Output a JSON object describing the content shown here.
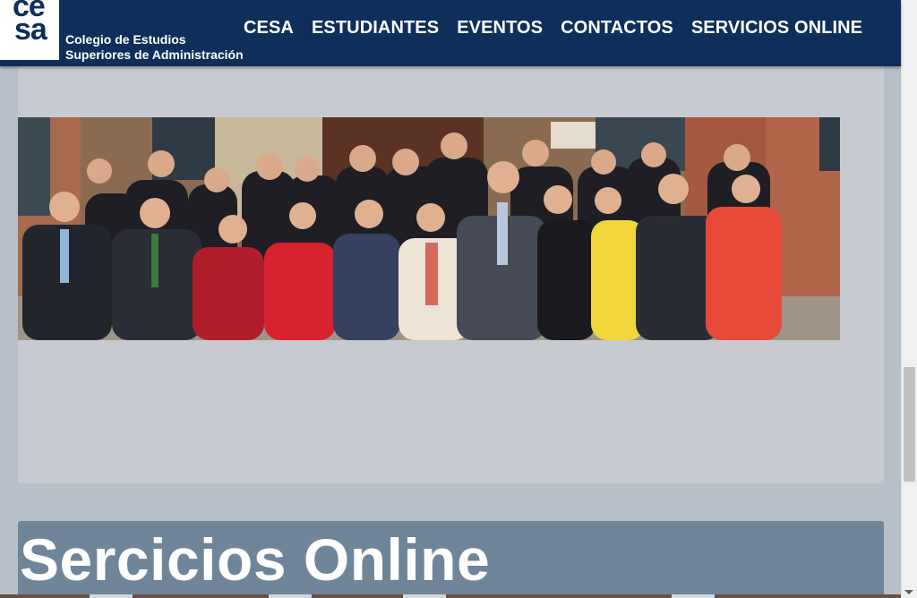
{
  "header": {
    "logo_mark_line1": "ce",
    "logo_mark_line2": "sa",
    "logo_line1": "Colegio de Estudios",
    "logo_line2": "Superiores de Administración",
    "nav": [
      {
        "label": "CESA"
      },
      {
        "label": "ESTUDIANTES"
      },
      {
        "label": "EVENTOS"
      },
      {
        "label": "CONTACTOS"
      },
      {
        "label": "SERVICIOS ONLINE"
      }
    ]
  },
  "hero": {
    "photo_subject": "group-photo-staff"
  },
  "services": {
    "title": "Sercicios Online"
  },
  "colors": {
    "header_bg": "#0d2f5a",
    "page_bg": "#b7c0c8",
    "panel_bg": "#c7cbd1",
    "services_bg": "#6f8599",
    "text_light": "#ffffff"
  }
}
